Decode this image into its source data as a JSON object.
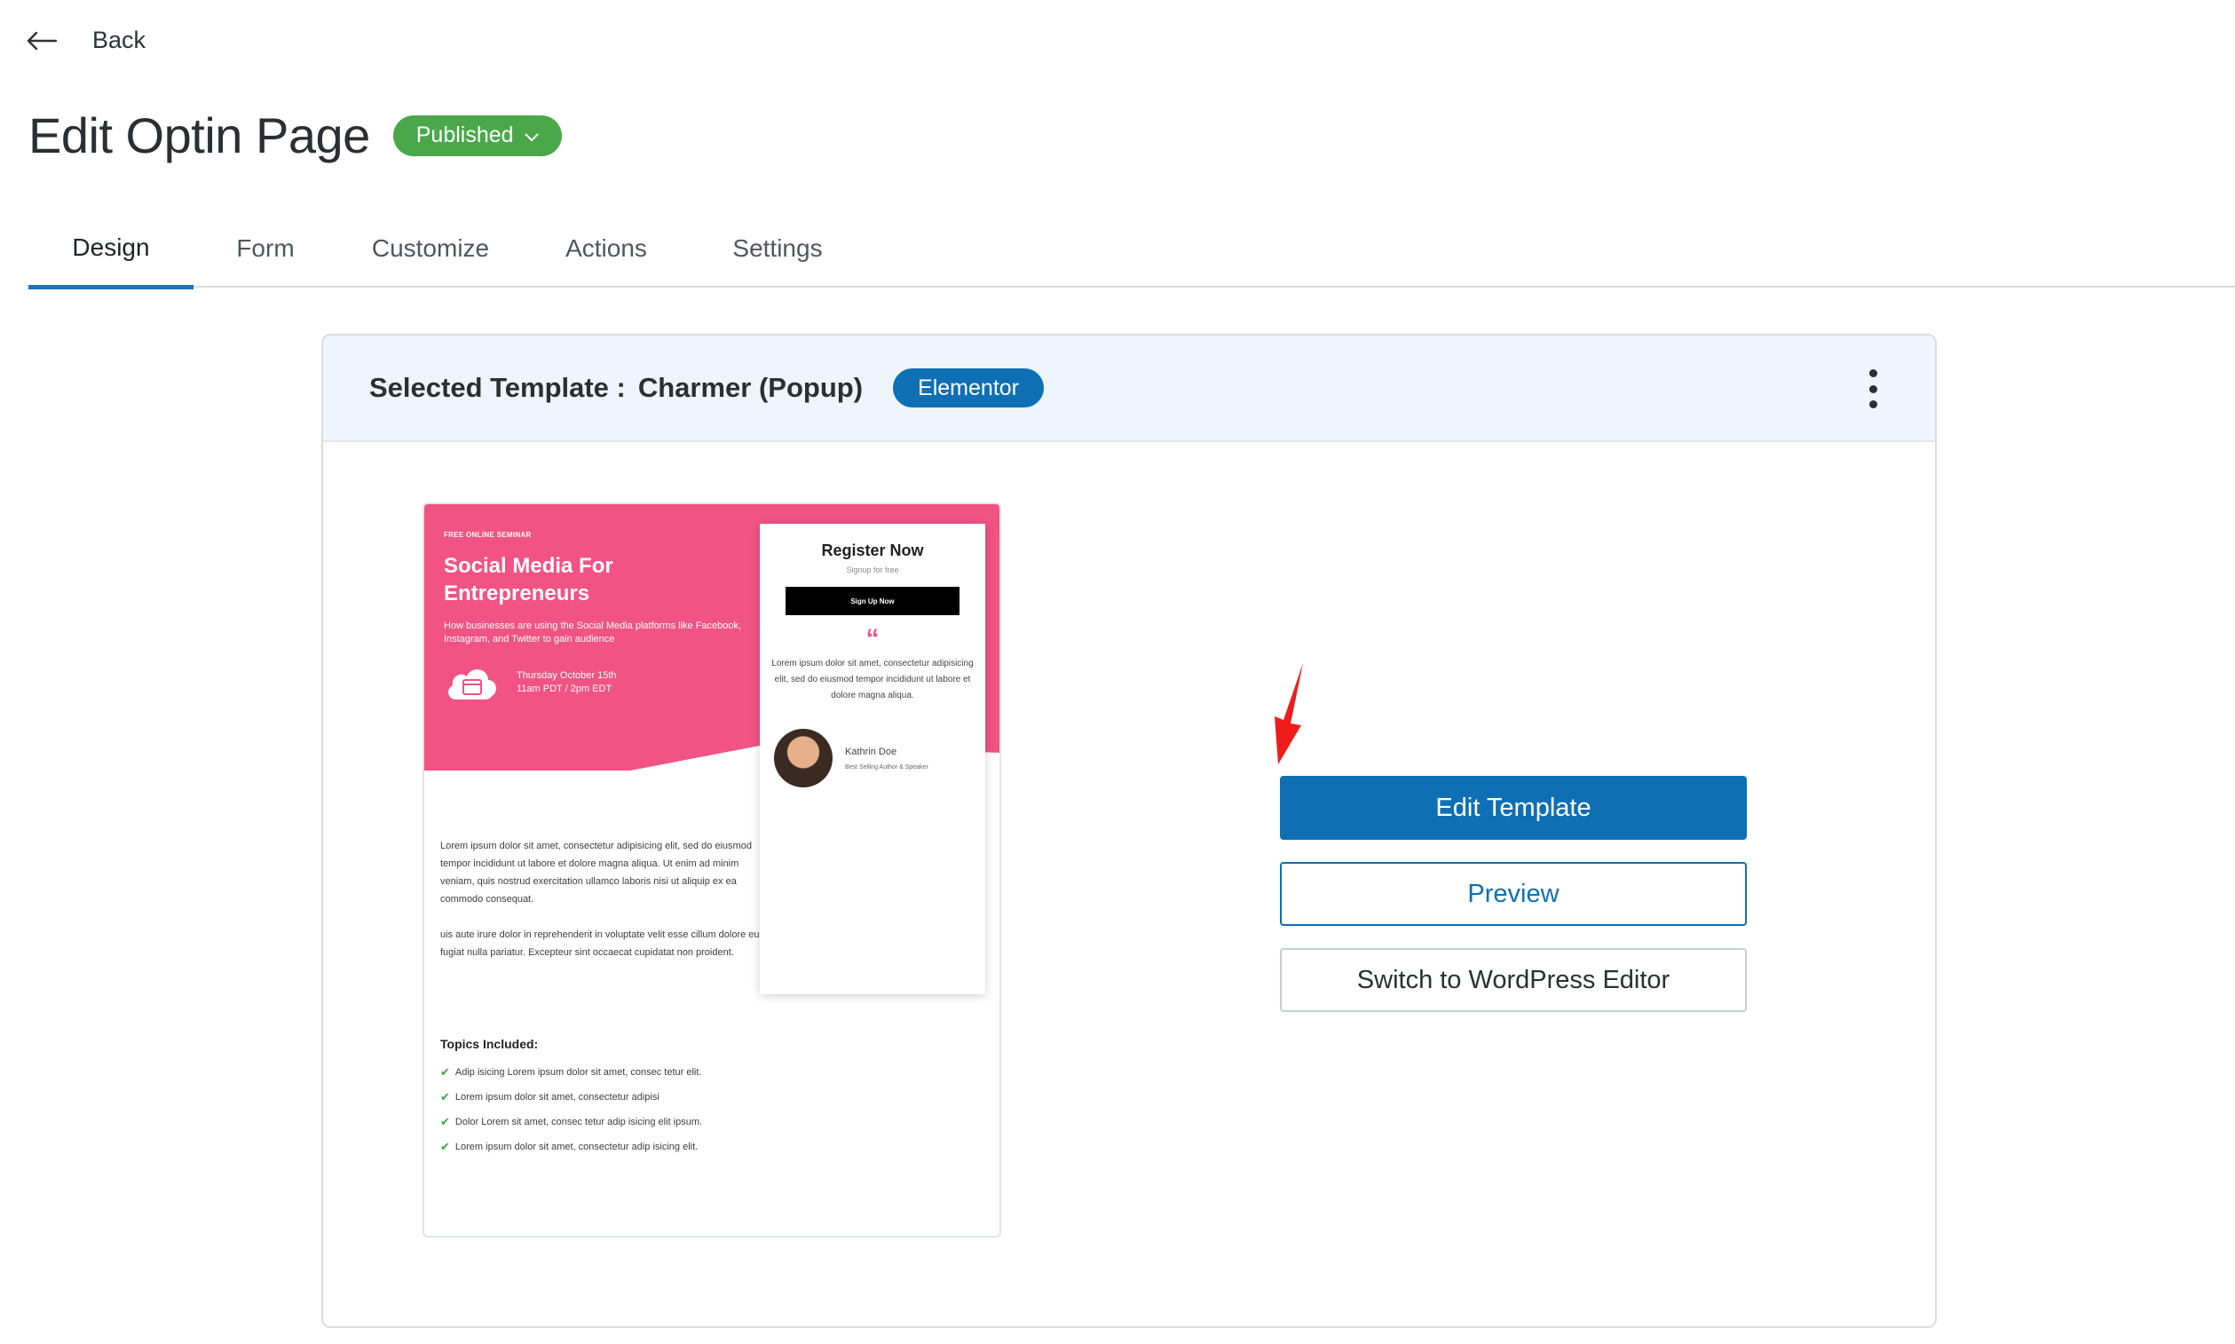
{
  "nav": {
    "back_label": "Back"
  },
  "header": {
    "title": "Edit Optin Page",
    "status": "Published"
  },
  "tabs": [
    {
      "label": "Design",
      "active": true
    },
    {
      "label": "Form",
      "active": false
    },
    {
      "label": "Customize",
      "active": false
    },
    {
      "label": "Actions",
      "active": false
    },
    {
      "label": "Settings",
      "active": false
    }
  ],
  "template_card": {
    "label": "Selected Template :",
    "name": "Charmer (Popup)",
    "builder_badge": "Elementor"
  },
  "thumbnail": {
    "kicker": "FREE ONLINE SEMINAR",
    "title": "Social Media For Entrepreneurs",
    "subtitle": "How businesses are using the Social Media platforms like Facebook, Instagram, and Twitter to gain audience",
    "event_date": "Thursday October 15th",
    "event_time": "11am PDT / 2pm EDT",
    "body_1": "Lorem ipsum dolor sit amet, consectetur adipisicing elit, sed do eiusmod tempor incididunt ut labore et dolore magna aliqua. Ut enim ad minim veniam, quis nostrud exercitation ullamco laboris nisi ut aliquip ex ea commodo consequat.",
    "body_2": "uis aute irure dolor in reprehenderit in voluptate velit esse cillum dolore eu fugiat nulla pariatur. Excepteur sint occaecat cupidatat non proident.",
    "topics_heading": "Topics Included:",
    "topics": [
      "Adip isicing Lorem ipsum dolor sit amet, consec tetur elit.",
      "Lorem ipsum dolor sit amet, consectetur adipisi",
      "Dolor Lorem sit amet, consec tetur adip isicing elit ipsum.",
      "Lorem ipsum dolor sit amet, consectetur adip isicing elit."
    ],
    "register_title": "Register Now",
    "register_sub": "Signup for free",
    "signup_button": "Sign Up Now",
    "quote_mark": "“",
    "quote_text": "Lorem ipsum dolor sit amet, consectetur adipisicing elit, sed do eiusmod tempor incididunt ut labore et dolore magna aliqua.",
    "author_name": "Kathrin Doe",
    "author_role": "Best Selling Author & Speaker",
    "accent_color": "#f05384"
  },
  "actions": {
    "edit_template": "Edit Template",
    "preview": "Preview",
    "switch_editor": "Switch to WordPress Editor"
  },
  "colors": {
    "primary": "#0e6fb5",
    "status_green": "#4aa84a",
    "annotation_arrow": "#f01c1c"
  }
}
